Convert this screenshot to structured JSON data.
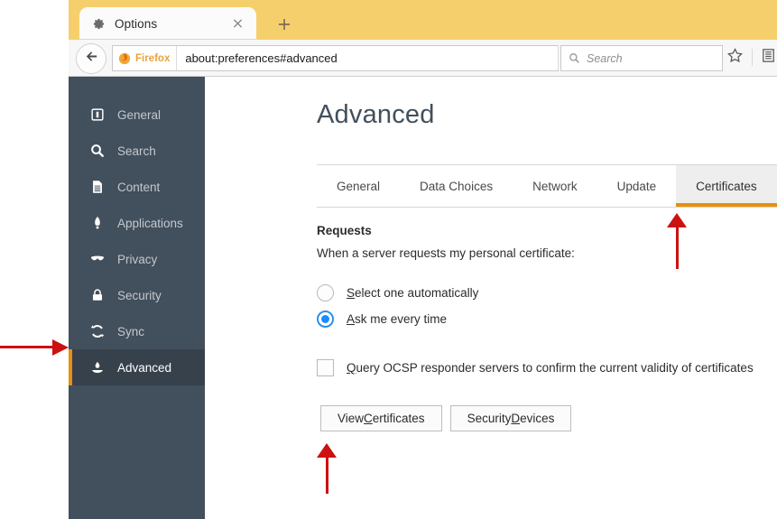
{
  "window": {
    "titlebar_color": "#f6cf6d",
    "tab": {
      "icon": "gear-icon",
      "label": "Options",
      "close_icon": "close-icon"
    },
    "new_tab_label": "+",
    "toolbar": {
      "back_icon": "back-arrow-icon",
      "identity_label": "Firefox",
      "identity_icon": "firefox-logo-icon",
      "url_value": "about:preferences#advanced",
      "reload_icon": "reload-icon",
      "search": {
        "icon": "search-icon",
        "placeholder": "Search",
        "value": ""
      },
      "bookmark_icon": "star-icon",
      "library_icon": "library-icon"
    }
  },
  "sidebar": {
    "background": "#424f5c",
    "accent_color": "#e8900c",
    "items": [
      {
        "label": "General",
        "icon": "general-icon",
        "selected": false
      },
      {
        "label": "Search",
        "icon": "search-icon",
        "selected": false
      },
      {
        "label": "Content",
        "icon": "content-icon",
        "selected": false
      },
      {
        "label": "Applications",
        "icon": "applications-icon",
        "selected": false
      },
      {
        "label": "Privacy",
        "icon": "privacy-mask-icon",
        "selected": false
      },
      {
        "label": "Security",
        "icon": "security-lock-icon",
        "selected": false
      },
      {
        "label": "Sync",
        "icon": "sync-icon",
        "selected": false
      },
      {
        "label": "Advanced",
        "icon": "advanced-flask-icon",
        "selected": true
      }
    ]
  },
  "main": {
    "title": "Advanced",
    "tabs": [
      {
        "label": "General",
        "active": false
      },
      {
        "label": "Data Choices",
        "active": false
      },
      {
        "label": "Network",
        "active": false
      },
      {
        "label": "Update",
        "active": false
      },
      {
        "label": "Certificates",
        "active": true
      }
    ],
    "section": {
      "heading": "Requests",
      "description": "When a server requests my personal certificate:",
      "radios": [
        {
          "accesskey": "S",
          "label_rest": "elect one automatically",
          "checked": false
        },
        {
          "accesskey": "A",
          "label_rest": "sk me every time",
          "checked": true
        }
      ],
      "checkbox": {
        "accesskey": "Q",
        "label_rest": "uery OCSP responder servers to confirm the current validity of certificates",
        "checked": false
      },
      "buttons": [
        {
          "pre": "View ",
          "accesskey": "C",
          "post": "ertificates"
        },
        {
          "pre": "Security ",
          "accesskey": "D",
          "post": "evices"
        }
      ]
    }
  },
  "annotations": {
    "color": "#cc1111",
    "arrows": [
      {
        "name": "arrow-to-sync",
        "direction": "right"
      },
      {
        "name": "arrow-to-certificates-tab",
        "direction": "up"
      },
      {
        "name": "arrow-to-view-certificates-button",
        "direction": "up"
      }
    ]
  }
}
